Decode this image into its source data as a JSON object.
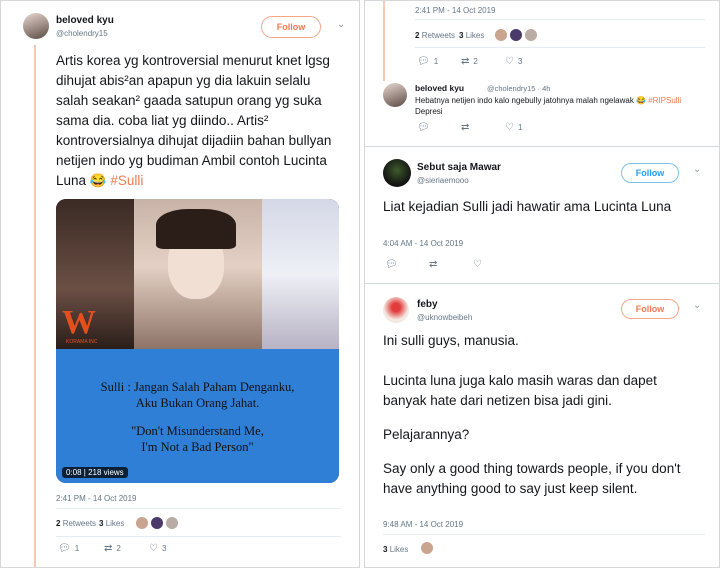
{
  "left": {
    "name": "beloved kyu",
    "handle": "@cholendry15",
    "follow": "Follow",
    "text_main": "Artis korea yg kontroversial menurut knet lgsg dihujat abis²an apapun yg dia lakuin selalu salah seakan² gaada satupun orang yg suka sama dia. coba liat yg diindo.. Artis² kontroversialnya dihujat dijadiin bahan bullyan netijen indo yg budiman Ambil contoh Lucinta Luna 😂",
    "hashtag": "#Sulli",
    "video": {
      "logo": "W",
      "logo_sub": "KORAMA INC",
      "caption_id_1": "Sulli : Jangan Salah Paham Denganku,",
      "caption_id_2": "Aku Bukan Orang Jahat.",
      "caption_en_1": "\"Don't Misunderstand Me,",
      "caption_en_2": "I'm Not a Bad Person\"",
      "duration": "0:08",
      "views": "218 views"
    },
    "timestamp": "2:41 PM - 14 Oct 2019",
    "retweets_count": "2",
    "retweets_label": "Retweets",
    "likes_count": "3",
    "likes_label": "Likes",
    "replies": "1",
    "rts": "2",
    "likes": "3"
  },
  "right": {
    "top_timestamp": "2:41 PM - 14 Oct 2019",
    "top_retweets_count": "2",
    "top_retweets_label": "Retweets",
    "top_likes_count": "3",
    "top_likes_label": "Likes",
    "top_replies": "1",
    "top_rts": "2",
    "top_likes": "3",
    "reply": {
      "name": "beloved kyu",
      "handle": "@cholendry15 · 4h",
      "text": "Hebatnya netijen indo kalo ngebully jatohnya malah ngelawak 😂",
      "hashtag": "#RIPSulli",
      "text2": "Depresi",
      "replies": "",
      "rts": "",
      "likes": "1"
    },
    "mawar": {
      "name": "Sebut saja Mawar",
      "handle": "@sieriaemooo",
      "follow": "Follow",
      "text": "Liat kejadian Sulli jadi hawatir ama Lucinta Luna",
      "timestamp": "4:04 AM - 14 Oct 2019"
    },
    "feby": {
      "name": "feby",
      "handle": "@uknowbeibeh",
      "follow": "Follow",
      "p1": "Ini sulli guys, manusia.",
      "p2": "Lucinta luna juga kalo masih waras dan dapet banyak hate dari netizen bisa jadi gini.",
      "p3": "Pelajarannya?",
      "p4": "Say only a good thing towards people, if you don't have anything good to say just keep silent.",
      "timestamp": "9:48 AM - 14 Oct 2019",
      "likes_count": "3",
      "likes_label": "Likes"
    }
  },
  "colors": {
    "accent": "#f27a52",
    "link": "#1da1f2",
    "muted": "#657786",
    "thread": "#f5c9b3"
  }
}
